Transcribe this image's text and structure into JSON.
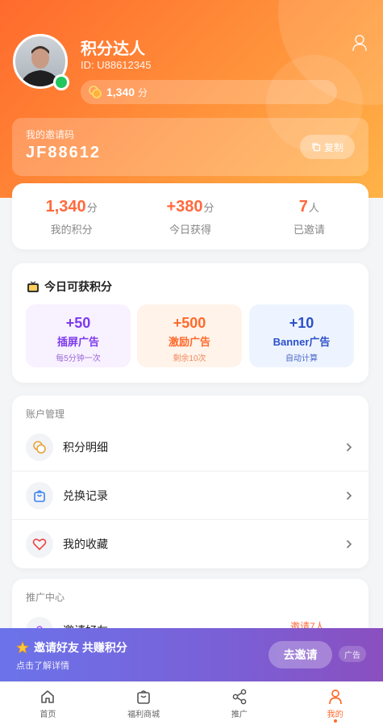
{
  "profile": {
    "name": "积分达人",
    "id": "ID: U88612345",
    "points_value": "1,340",
    "points_unit": "分",
    "online": true
  },
  "invite": {
    "label": "我的邀请码",
    "code": "JF88612",
    "copy_label": "复制"
  },
  "stats": [
    {
      "value": "1,340",
      "unit": "分",
      "label": "我的积分"
    },
    {
      "value": "+380",
      "unit": "分",
      "label": "今日获得"
    },
    {
      "value": "7",
      "unit": "人",
      "label": "已邀请"
    }
  ],
  "today": {
    "title": "今日可获积分",
    "ads": [
      {
        "amount": "+50",
        "name": "插屏广告",
        "sub": "每5分钟一次"
      },
      {
        "amount": "+500",
        "name": "激励广告",
        "sub": "剩余10次"
      },
      {
        "amount": "+10",
        "name": "Banner广告",
        "sub": "自动计算"
      }
    ]
  },
  "account": {
    "title": "账户管理",
    "items": [
      {
        "label": "积分明细",
        "icon": "coins-icon"
      },
      {
        "label": "兑换记录",
        "icon": "bag-icon"
      },
      {
        "label": "我的收藏",
        "icon": "heart-icon"
      }
    ]
  },
  "promo": {
    "title": "推广中心",
    "first_item_label": "邀请好友",
    "first_item_right": "邀请7人"
  },
  "banner": {
    "title": "邀请好友 共赚积分",
    "subtitle": "点击了解详情",
    "button": "去邀请",
    "ad_tag": "广告"
  },
  "tabbar": {
    "items": [
      {
        "label": "首页",
        "icon": "home-icon"
      },
      {
        "label": "福利商城",
        "icon": "shop-bag-icon"
      },
      {
        "label": "推广",
        "icon": "share-icon"
      },
      {
        "label": "我的",
        "icon": "user-icon"
      }
    ],
    "active_index": 3
  },
  "colors": {
    "accent": "#ff6a2c",
    "stat_value": "#ff6a3d",
    "online": "#22c55e",
    "banner_start": "#6b73ea",
    "banner_end": "#8a4fbf"
  }
}
